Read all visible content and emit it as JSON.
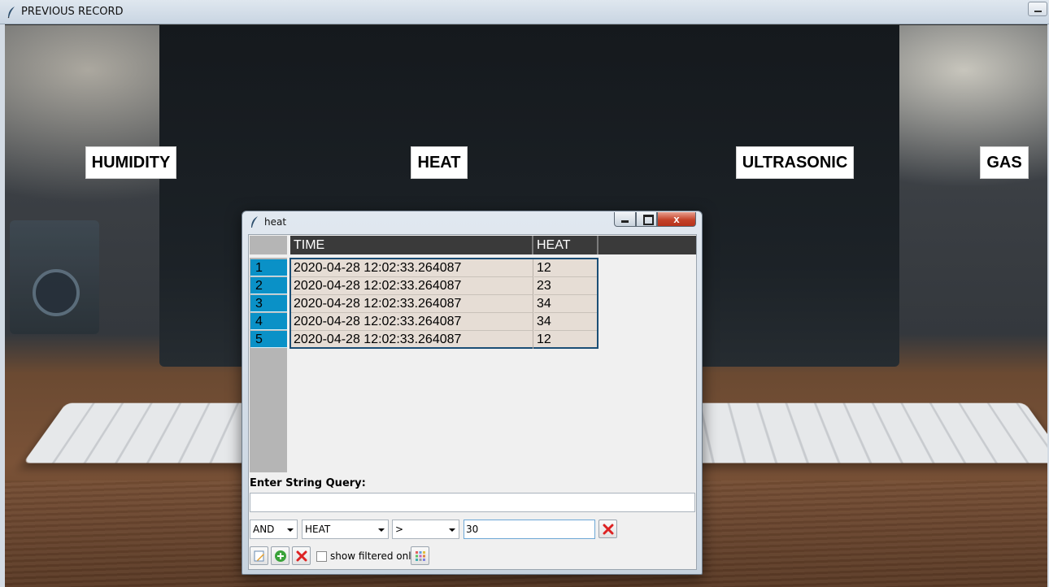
{
  "window": {
    "title": "PREVIOUS RECORD"
  },
  "sensors": [
    {
      "label": "HUMIDITY"
    },
    {
      "label": "HEAT"
    },
    {
      "label": "ULTRASONIC"
    },
    {
      "label": "GAS"
    }
  ],
  "child_window": {
    "title": "heat",
    "close_label": "x",
    "table": {
      "columns": [
        "TIME",
        "HEAT"
      ],
      "rows": [
        {
          "index": "1",
          "time": "2020-04-28 12:02:33.264087",
          "heat": "12"
        },
        {
          "index": "2",
          "time": "2020-04-28 12:02:33.264087",
          "heat": "23"
        },
        {
          "index": "3",
          "time": "2020-04-28 12:02:33.264087",
          "heat": "34"
        },
        {
          "index": "4",
          "time": "2020-04-28 12:02:33.264087",
          "heat": "34"
        },
        {
          "index": "5",
          "time": "2020-04-28 12:02:33.264087",
          "heat": "12"
        }
      ]
    },
    "query": {
      "label": "Enter String Query:",
      "value": "",
      "logic": "AND",
      "column": "HEAT",
      "operator": ">",
      "filter_value": "30",
      "show_filtered_label": "show filtered only",
      "show_filtered_checked": false
    }
  },
  "colors": {
    "row_header": "#0a91c7",
    "column_header": "#3a3a3a",
    "cell_bg": "#e6ddd5",
    "selection_border": "#1c4e75"
  },
  "icons": [
    "feather-icon",
    "minimize-icon",
    "maximize-icon",
    "close-icon",
    "delete-icon",
    "edit-icon",
    "add-icon",
    "remove-icon",
    "grid-icon"
  ]
}
